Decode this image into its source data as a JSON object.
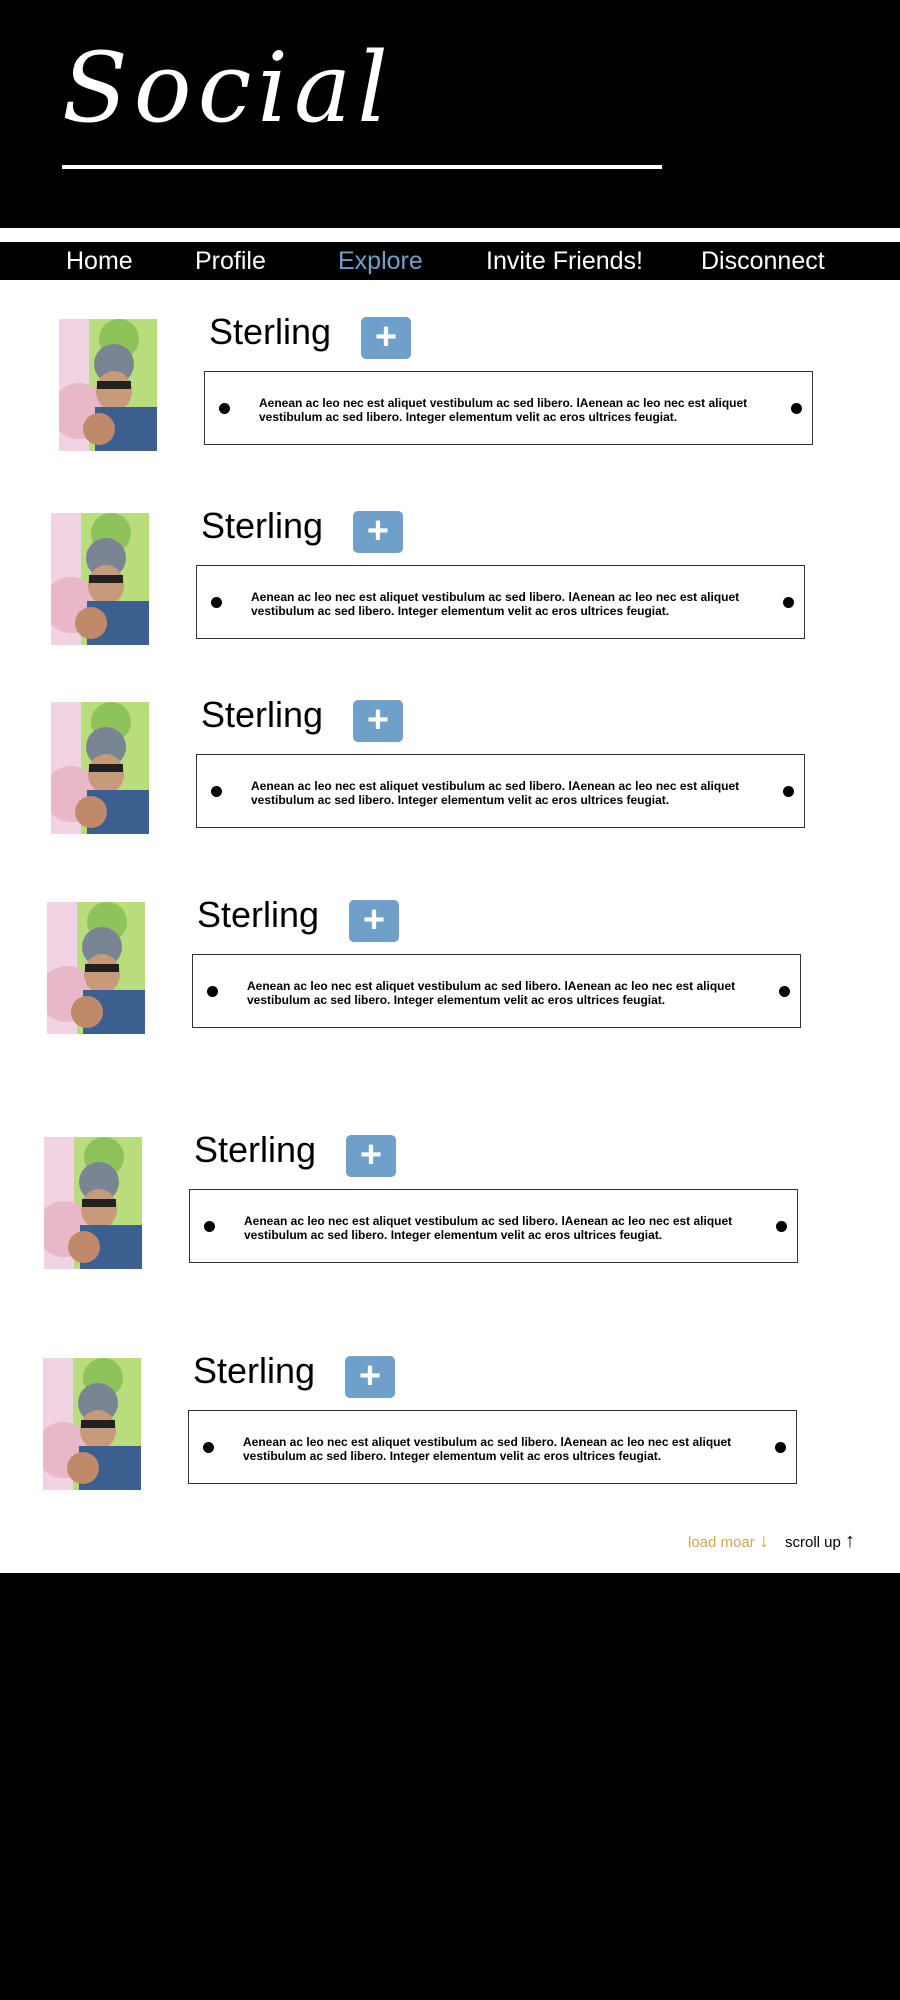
{
  "header": {
    "logo": "Social"
  },
  "nav": {
    "items": [
      {
        "label": "Home"
      },
      {
        "label": "Profile"
      },
      {
        "label": "Explore"
      },
      {
        "label": "Invite Friends!"
      },
      {
        "label": "Disconnect"
      }
    ],
    "active_color": "#6fa0c9"
  },
  "posts": [
    {
      "name": "Sterling",
      "add_label": "+",
      "text": "Aenean ac leo nec est aliquet vestibulum ac sed libero. lAenean ac leo nec est aliquet vestibulum ac sed libero. Integer elementum velit ac eros ultrices feugiat."
    },
    {
      "name": "Sterling",
      "add_label": "+",
      "text": "Aenean ac leo nec est aliquet vestibulum ac sed libero. lAenean ac leo nec est aliquet vestibulum ac sed libero. Integer elementum velit ac eros ultrices feugiat."
    },
    {
      "name": "Sterling",
      "add_label": "+",
      "text": "Aenean ac leo nec est aliquet vestibulum ac sed libero. lAenean ac leo nec est aliquet vestibulum ac sed libero. Integer elementum velit ac eros ultrices feugiat."
    },
    {
      "name": "Sterling",
      "add_label": "+",
      "text": "Aenean ac leo nec est aliquet vestibulum ac sed libero. lAenean ac leo nec est aliquet vestibulum ac sed libero. Integer elementum velit ac eros ultrices feugiat."
    },
    {
      "name": "Sterling",
      "add_label": "+",
      "text": "Aenean ac leo nec est aliquet vestibulum ac sed libero. lAenean ac leo nec est aliquet vestibulum ac sed libero. Integer elementum velit ac eros ultrices feugiat."
    },
    {
      "name": "Sterling",
      "add_label": "+",
      "text": "Aenean ac leo nec est aliquet vestibulum ac sed libero. lAenean ac leo nec est aliquet vestibulum ac sed libero. Integer elementum velit ac eros ultrices feugiat."
    }
  ],
  "footer": {
    "load_more": "load moar",
    "load_more_arrow": "↓",
    "scroll_up": "scroll up",
    "scroll_up_arrow": "↑",
    "load_more_color": "#d4a35a"
  },
  "colors": {
    "background": "#000000",
    "content": "#ffffff",
    "button": "#6fa0c9"
  }
}
